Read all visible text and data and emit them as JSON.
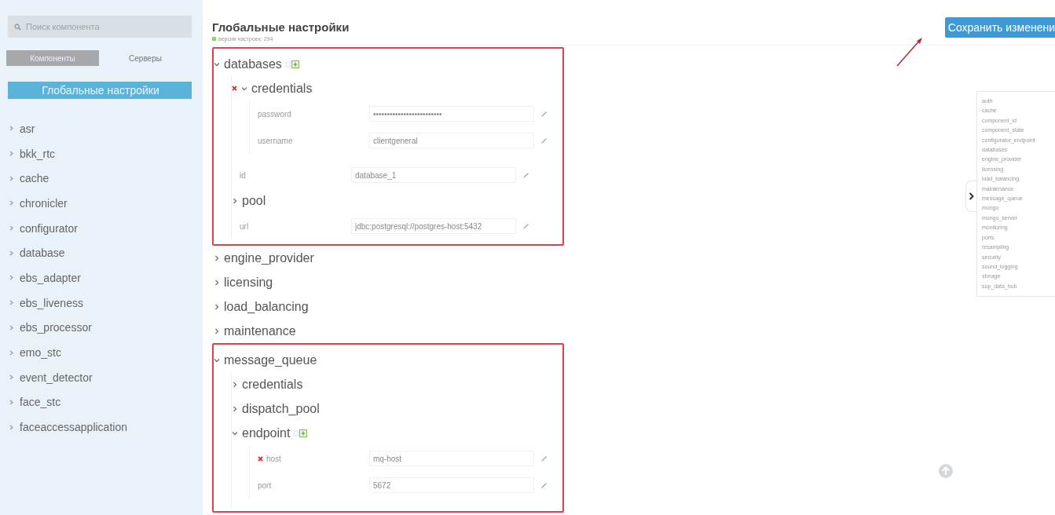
{
  "sidebar": {
    "search": {
      "placeholder": "Поиск компонента"
    },
    "tabs": [
      {
        "label": "Компоненты",
        "selected": true
      },
      {
        "label": "Серверы",
        "selected": false
      }
    ],
    "items": [
      {
        "label": "Глобальные настройки",
        "selected": true
      },
      {
        "label": "asr",
        "selected": false
      },
      {
        "label": "bkk_rtc",
        "selected": false
      },
      {
        "label": "cache",
        "selected": false
      },
      {
        "label": "chronicler",
        "selected": false
      },
      {
        "label": "configurator",
        "selected": false
      },
      {
        "label": "database",
        "selected": false
      },
      {
        "label": "ebs_adapter",
        "selected": false
      },
      {
        "label": "ebs_liveness",
        "selected": false
      },
      {
        "label": "ebs_processor",
        "selected": false
      },
      {
        "label": "emo_stc",
        "selected": false
      },
      {
        "label": "event_detector",
        "selected": false
      },
      {
        "label": "face_stc",
        "selected": false
      },
      {
        "label": "faceaccessapplication",
        "selected": false
      }
    ]
  },
  "header": {
    "title": "Глобальные настройки",
    "version": "версия настроек: 294",
    "save_button": "Сохранить изменени"
  },
  "tree": [
    {
      "kind": "group",
      "label": "databases",
      "expanded": true,
      "highlighted": true,
      "error": false,
      "addable": true,
      "children": [
        {
          "kind": "group",
          "label": "credentials",
          "expanded": true,
          "error": true,
          "addable": false,
          "children": [
            {
              "kind": "field",
              "label": "password",
              "value": "•••••••••••••••••••••••••",
              "error": false
            },
            {
              "kind": "field",
              "label": "username",
              "value": "clientgeneral",
              "error": false
            }
          ]
        },
        {
          "kind": "field",
          "label": "id",
          "value": "database_1",
          "error": false
        },
        {
          "kind": "group",
          "label": "pool",
          "expanded": false,
          "error": false,
          "addable": false
        },
        {
          "kind": "field",
          "label": "url",
          "value": "jdbc:postgresql://postgres-host:5432",
          "error": false
        }
      ]
    },
    {
      "kind": "group",
      "label": "engine_provider",
      "expanded": false,
      "highlighted": false,
      "error": false,
      "addable": false
    },
    {
      "kind": "group",
      "label": "licensing",
      "expanded": false,
      "highlighted": false,
      "error": false,
      "addable": false
    },
    {
      "kind": "group",
      "label": "load_balancing",
      "expanded": false,
      "highlighted": false,
      "error": false,
      "addable": false
    },
    {
      "kind": "group",
      "label": "maintenance",
      "expanded": false,
      "highlighted": false,
      "error": false,
      "addable": false
    },
    {
      "kind": "group",
      "label": "message_queue",
      "expanded": true,
      "highlighted": true,
      "error": false,
      "addable": false,
      "children": [
        {
          "kind": "group",
          "label": "credentials",
          "expanded": false,
          "error": false,
          "addable": false
        },
        {
          "kind": "group",
          "label": "dispatch_pool",
          "expanded": false,
          "error": false,
          "addable": false
        },
        {
          "kind": "group",
          "label": "endpoint",
          "expanded": true,
          "error": false,
          "addable": true,
          "children": [
            {
              "kind": "field",
              "label": "host",
              "value": "mq-host",
              "error": true
            },
            {
              "kind": "field",
              "label": "port",
              "value": "5672",
              "error": false
            }
          ]
        }
      ]
    }
  ],
  "outline": [
    "auth",
    "cache",
    "component_id",
    "component_state",
    "configurator_endpoint",
    "databases",
    "engine_provider",
    "licensing",
    "load_balancing",
    "maintenance",
    "message_queue",
    "mongo",
    "mongo_server",
    "monitoring",
    "ports",
    "resampling",
    "security",
    "sound_logging",
    "storage",
    "sup_data_hub"
  ]
}
